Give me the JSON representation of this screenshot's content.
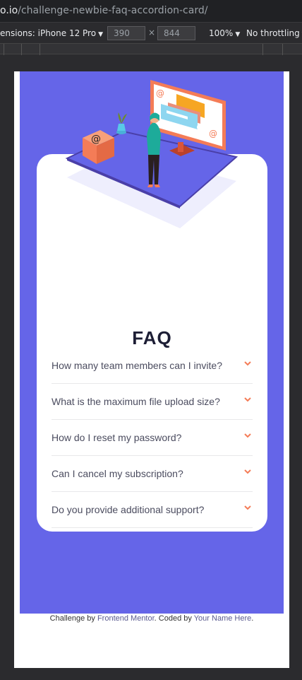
{
  "browser": {
    "url_prefix": "o.io",
    "url_path": "/challenge-newbie-faq-accordion-card/"
  },
  "devtools": {
    "dimensions_label": "ensions: iPhone 12 Pro",
    "width_value": "390",
    "height_value": "844",
    "times": "×",
    "zoom": "100%",
    "throttling": "No throttling"
  },
  "page": {
    "heading": "FAQ",
    "questions": [
      "How many team members can I invite?",
      "What is the maximum file upload size?",
      "How do I reset my password?",
      "Can I cancel my subscription?",
      "Do you provide additional support?"
    ],
    "footer": {
      "prefix": "Challenge by ",
      "mentor": "Frontend Mentor",
      "middle": ". Coded by ",
      "author": "Your Name Here",
      "suffix": "."
    }
  },
  "colors": {
    "background": "#6565e8",
    "card": "#ffffff",
    "accent": "#f47c57",
    "heading": "#1d1e35"
  }
}
